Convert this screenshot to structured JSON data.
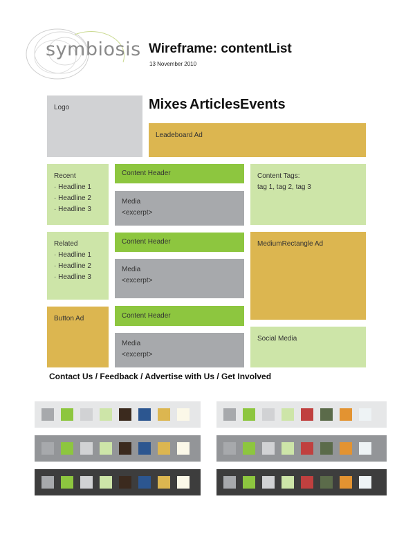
{
  "header": {
    "brand": "symbiosis",
    "title": "Wireframe: contentList",
    "date": "13 November 2010"
  },
  "nav": {
    "items": [
      "Mixes",
      "Articles",
      "Events"
    ]
  },
  "logo_label": "Logo",
  "leaderboard_label": "Leadeboard Ad",
  "recent": {
    "title": "Recent",
    "items": [
      "Headline 1",
      "Headline 2",
      "Headline 3"
    ]
  },
  "related": {
    "title": "Related",
    "items": [
      "Headline 1",
      "Headline 2",
      "Headline 3"
    ]
  },
  "button_ad_label": "Button Ad",
  "content_items": [
    {
      "header": "Content Header",
      "media": "Media",
      "excerpt": "<excerpt>"
    },
    {
      "header": "Content Header",
      "media": "Media",
      "excerpt": "<excerpt>"
    },
    {
      "header": "Content Header",
      "media": "Media",
      "excerpt": "<excerpt>"
    }
  ],
  "content_tags": {
    "title": "Content Tags:",
    "tags": "tag 1, tag 2, tag 3"
  },
  "medium_rect_label": "MediumRectangle Ad",
  "social_label": "Social Media",
  "footer": {
    "links": [
      "Contact Us",
      "Feedback",
      "Advertise with Us",
      "Get Involved"
    ],
    "separator": "/"
  },
  "colors": {
    "gray_light": "#d1d2d4",
    "gray_mid": "#a7a9ac",
    "green_light": "#cde5a8",
    "green": "#8dc63f",
    "gold": "#dcb650"
  },
  "palettes": {
    "left_swatches": [
      "#a7a9ac",
      "#8dc63f",
      "#d1d2d4",
      "#cde5a8",
      "#3b2a1e",
      "#2c5690",
      "#dcb650",
      "#fbf8e8"
    ],
    "right_swatches": [
      "#a7a9ac",
      "#8dc63f",
      "#d1d2d4",
      "#cde5a8",
      "#c0403f",
      "#5b6b4a",
      "#e39331",
      "#eef3f5"
    ],
    "rows": [
      {
        "background": "#e6e7e8"
      },
      {
        "background": "#939598"
      },
      {
        "background": "#3d3d3d"
      }
    ]
  }
}
